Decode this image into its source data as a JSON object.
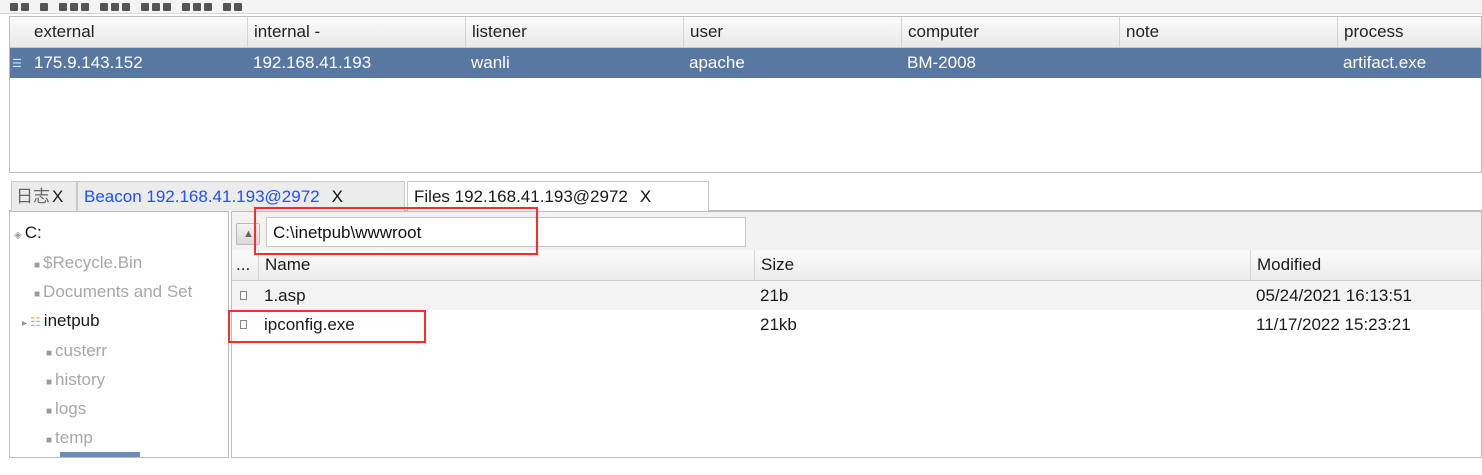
{
  "toolbar": {
    "icons": [
      "connect-icon",
      "disconnect-icon",
      "headphones-icon",
      "list-icon",
      "target-icon",
      "screenshot-icon",
      "download-icon",
      "key-icon",
      "keyboard-icon",
      "settings-icon",
      "cloud-icon",
      "notes-icon",
      "web-icon",
      "link-icon",
      "shell-icon",
      "info-icon",
      "log-icon"
    ]
  },
  "beacons": {
    "columns": [
      "external",
      "internal -",
      "listener",
      "user",
      "computer",
      "note",
      "process"
    ],
    "rows": [
      {
        "external": "175.9.143.152",
        "internal": "192.168.41.193",
        "listener": "wanli",
        "user": "apache",
        "computer": "BM-2008",
        "note": "",
        "process": "artifact.exe"
      }
    ]
  },
  "tabs": [
    {
      "label": "日志",
      "close": "X"
    },
    {
      "label": "Beacon 192.168.41.193@2972",
      "close": "X"
    },
    {
      "label": "Files 192.168.41.193@2972",
      "close": "X"
    }
  ],
  "tree": {
    "root": "C:",
    "items": [
      "$Recycle.Bin",
      "Documents and Set",
      "inetpub",
      "custerr",
      "history",
      "logs",
      "temp"
    ]
  },
  "files": {
    "path": "C:\\inetpub\\wwwroot",
    "columns": [
      "...",
      "Name",
      "Size",
      "Modified"
    ],
    "rows": [
      {
        "name": "1.asp",
        "size": "21b",
        "modified": "05/24/2021 16:13:51"
      },
      {
        "name": "ipconfig.exe",
        "size": "21kb",
        "modified": "11/17/2022 15:23:21"
      }
    ]
  },
  "colors": {
    "selection": "#5878a2",
    "highlight": "#ff2a2a",
    "tab_link": "#2050ff"
  }
}
